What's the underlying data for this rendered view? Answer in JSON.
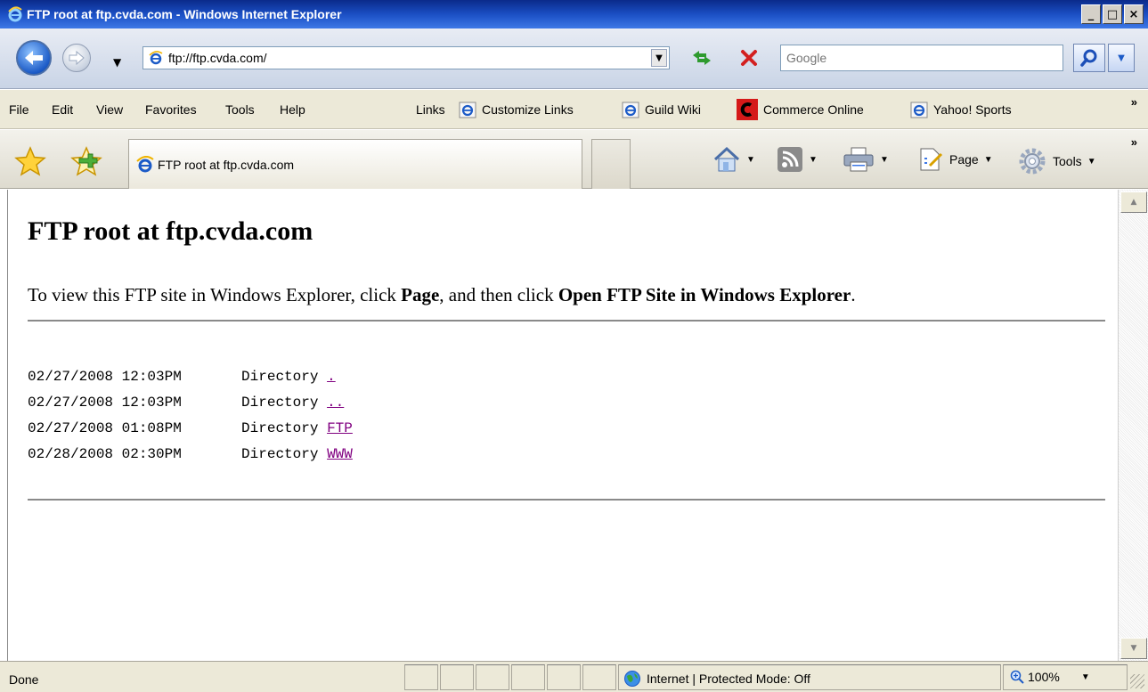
{
  "window": {
    "title": "FTP root at ftp.cvda.com - Windows Internet Explorer",
    "controls": [
      "_",
      "□",
      "×"
    ]
  },
  "navbar": {
    "address": "ftp://ftp.cvda.com/",
    "search_placeholder": "Google"
  },
  "menubar": {
    "items": [
      "File",
      "Edit",
      "View",
      "Favorites",
      "Tools",
      "Help"
    ],
    "links_label": "Links",
    "links": [
      "Customize Links",
      "Guild Wiki",
      "Commerce Online",
      "Yahoo! Sports"
    ],
    "overflow": "»"
  },
  "tabbar": {
    "tab_title": "FTP root at ftp.cvda.com",
    "page_label": "Page",
    "tools_label": "Tools",
    "overflow": "»"
  },
  "page": {
    "heading": "FTP root at ftp.cvda.com",
    "instructions": {
      "prefix": "To view this FTP site in Windows Explorer, click ",
      "bold1": "Page",
      "middle": ", and then click ",
      "bold2": "Open FTP Site in Windows Explorer",
      "suffix": "."
    },
    "listing": [
      {
        "datetime": "02/27/2008 12:03PM",
        "type": "Directory",
        "name": "."
      },
      {
        "datetime": "02/27/2008 12:03PM",
        "type": "Directory",
        "name": ".."
      },
      {
        "datetime": "02/27/2008 01:08PM",
        "type": "Directory",
        "name": "FTP"
      },
      {
        "datetime": "02/28/2008 02:30PM",
        "type": "Directory",
        "name": "WWW"
      }
    ]
  },
  "statusbar": {
    "status": "Done",
    "zone": "Internet | Protected Mode: Off",
    "zoom": "100%"
  },
  "colors": {
    "visited_link": "#800080",
    "titlebar": "#1b4fc4"
  }
}
